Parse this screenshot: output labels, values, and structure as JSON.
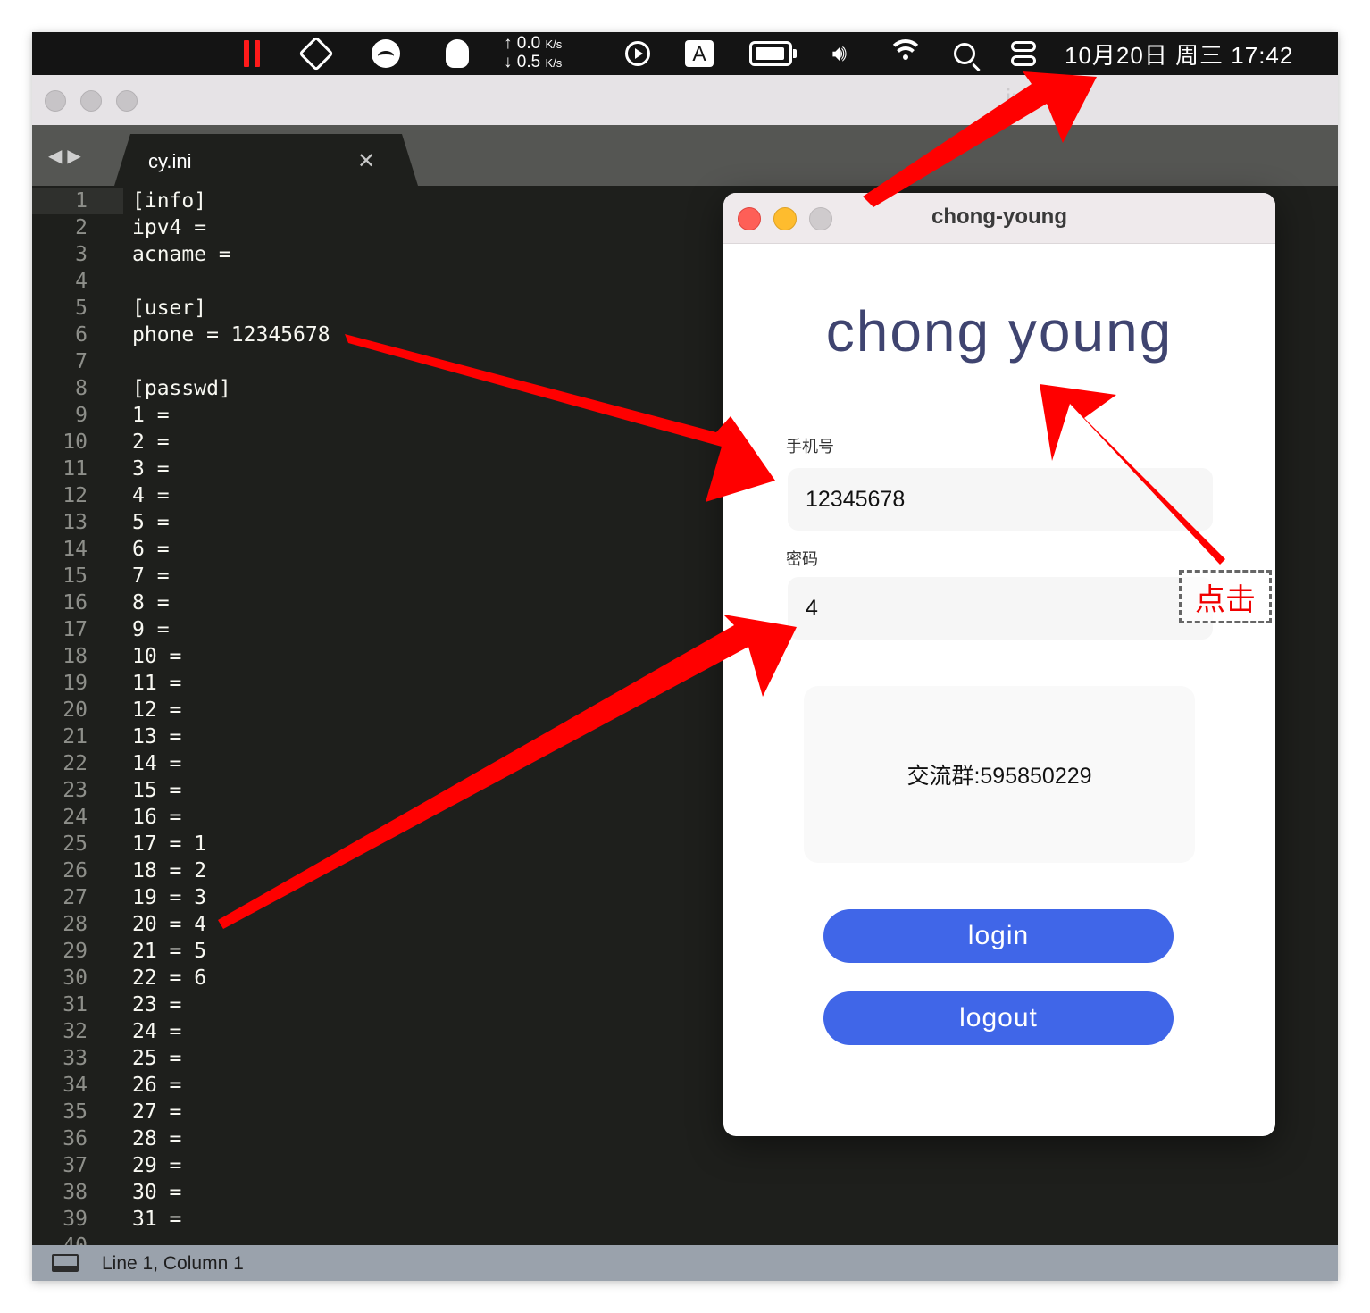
{
  "menubar": {
    "net_up": "0.0",
    "net_down": "0.5",
    "net_unit": "K/s",
    "input_source": "A",
    "datetime": "10月20日 周三  17:42",
    "icons": [
      "pause-icon",
      "diamond-icon",
      "photo-icon",
      "qq-icon",
      "play-icon",
      "input-source-icon",
      "battery-icon",
      "volume-icon",
      "wifi-icon",
      "search-icon",
      "control-center-icon"
    ]
  },
  "editor": {
    "window_title": "ini",
    "tab_title": "cy.ini",
    "tab_close": "✕",
    "lines": [
      "[info]",
      "ipv4 =",
      "acname =",
      "",
      "[user]",
      "phone = 12345678",
      "",
      "[passwd]",
      "1 =",
      "2 =",
      "3 =",
      "4 =",
      "5 =",
      "6 =",
      "7 =",
      "8 =",
      "9 =",
      "10 =",
      "11 =",
      "12 =",
      "13 =",
      "14 =",
      "15 =",
      "16 =",
      "17 = 1",
      "18 = 2",
      "19 = 3",
      "20 = 4",
      "21 = 5",
      "22 = 6",
      "23 =",
      "24 =",
      "25 =",
      "26 =",
      "27 =",
      "28 =",
      "29 =",
      "30 =",
      "31 =",
      ""
    ],
    "status": "Line 1, Column 1",
    "colors": {
      "background": "#1e1f1c",
      "text": "#f8f8f2",
      "gutter": "#8e8f8a"
    }
  },
  "app": {
    "title": "chong-young",
    "logo": "chong young",
    "phone_label": "手机号",
    "phone_value": "12345678",
    "password_label": "密码",
    "password_value": "4",
    "group_text": "交流群:595850229",
    "login_label": "login",
    "logout_label": "logout",
    "colors": {
      "button": "#4066e8",
      "logo": "#3f4470",
      "close": "#fe5f57",
      "minimize": "#febc2e"
    }
  },
  "annotation": {
    "click_label": "点击",
    "arrow_color": "#ff0000"
  }
}
